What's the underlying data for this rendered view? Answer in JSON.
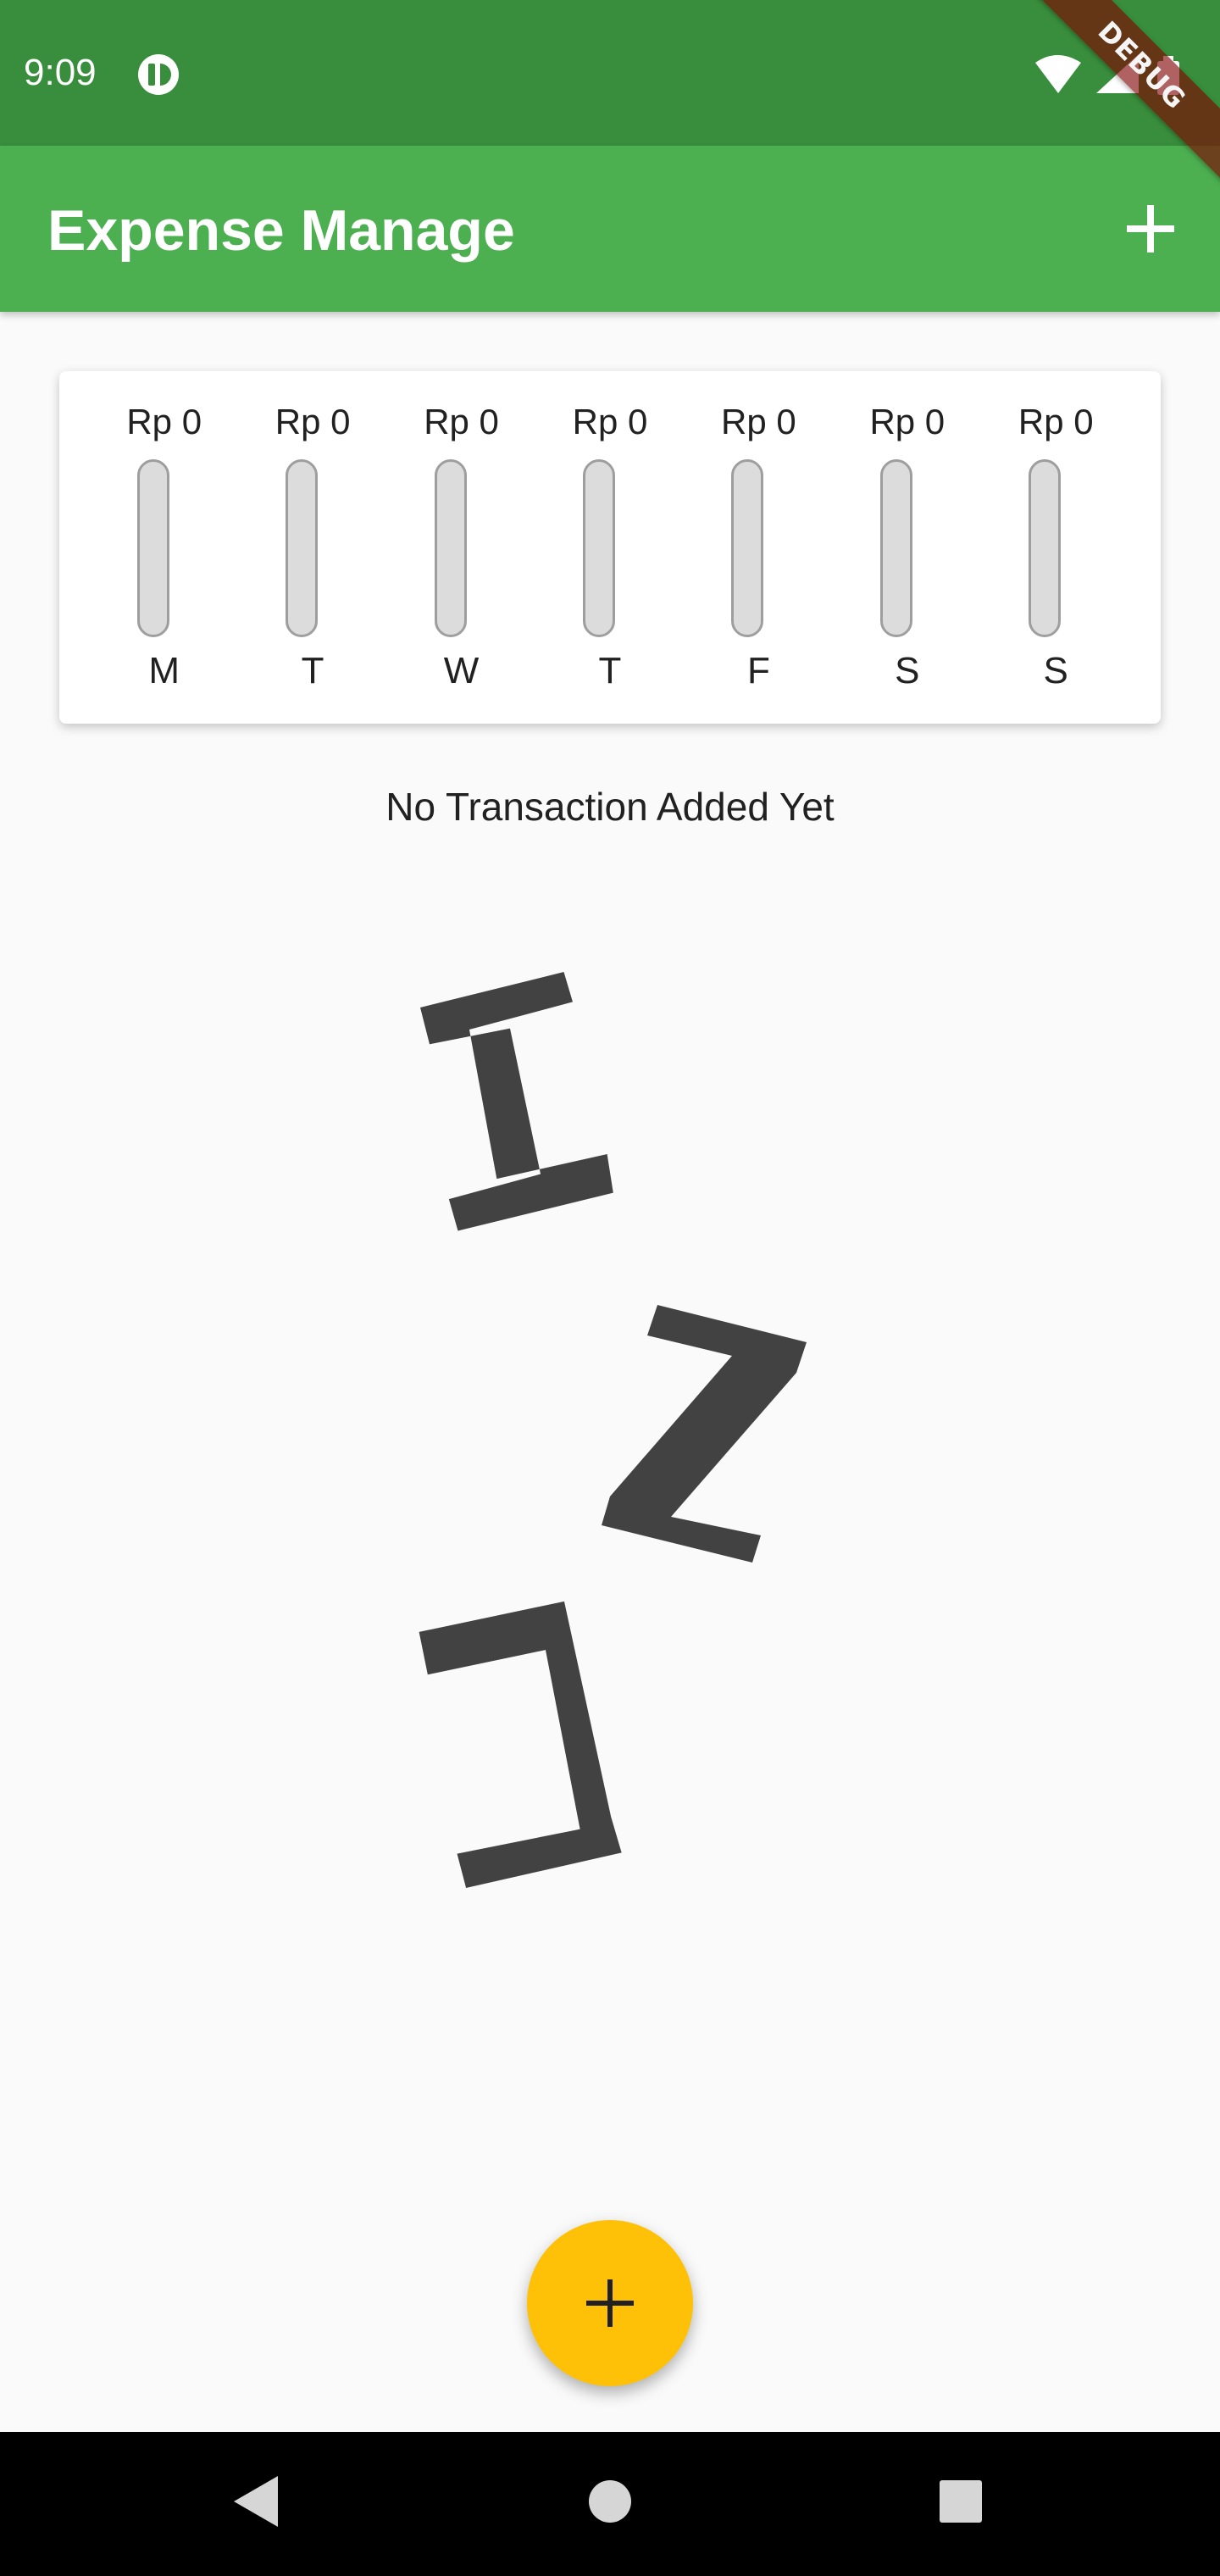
{
  "status_bar": {
    "time": "9:09",
    "icons": [
      "app-notification-icon",
      "wifi-icon",
      "signal-icon",
      "battery-icon"
    ],
    "debug_banner": "DEBUG"
  },
  "app_bar": {
    "title": "Expense Manage",
    "action_icon": "add-icon",
    "color": "#4caf50"
  },
  "chart": {
    "bars": [
      {
        "day": "M",
        "amount": "Rp 0",
        "fill_fraction": 0
      },
      {
        "day": "T",
        "amount": "Rp 0",
        "fill_fraction": 0
      },
      {
        "day": "W",
        "amount": "Rp 0",
        "fill_fraction": 0
      },
      {
        "day": "T",
        "amount": "Rp 0",
        "fill_fraction": 0
      },
      {
        "day": "F",
        "amount": "Rp 0",
        "fill_fraction": 0
      },
      {
        "day": "S",
        "amount": "Rp 0",
        "fill_fraction": 0
      },
      {
        "day": "S",
        "amount": "Rp 0",
        "fill_fraction": 0
      }
    ]
  },
  "chart_data": {
    "type": "bar",
    "categories": [
      "M",
      "T",
      "W",
      "T",
      "F",
      "S",
      "S"
    ],
    "values": [
      0,
      0,
      0,
      0,
      0,
      0,
      0
    ],
    "tick_labels": [
      "Rp 0",
      "Rp 0",
      "Rp 0",
      "Rp 0",
      "Rp 0",
      "Rp 0",
      "Rp 0"
    ],
    "title": "",
    "xlabel": "",
    "ylabel": ""
  },
  "empty_state": {
    "message": "No Transaction Added Yet",
    "illustration": "sleeping-zzz-icon"
  },
  "fab": {
    "icon": "add-icon",
    "color": "#ffc107"
  },
  "nav_bar": {
    "icons": [
      "back-icon",
      "home-icon",
      "recents-icon"
    ]
  }
}
